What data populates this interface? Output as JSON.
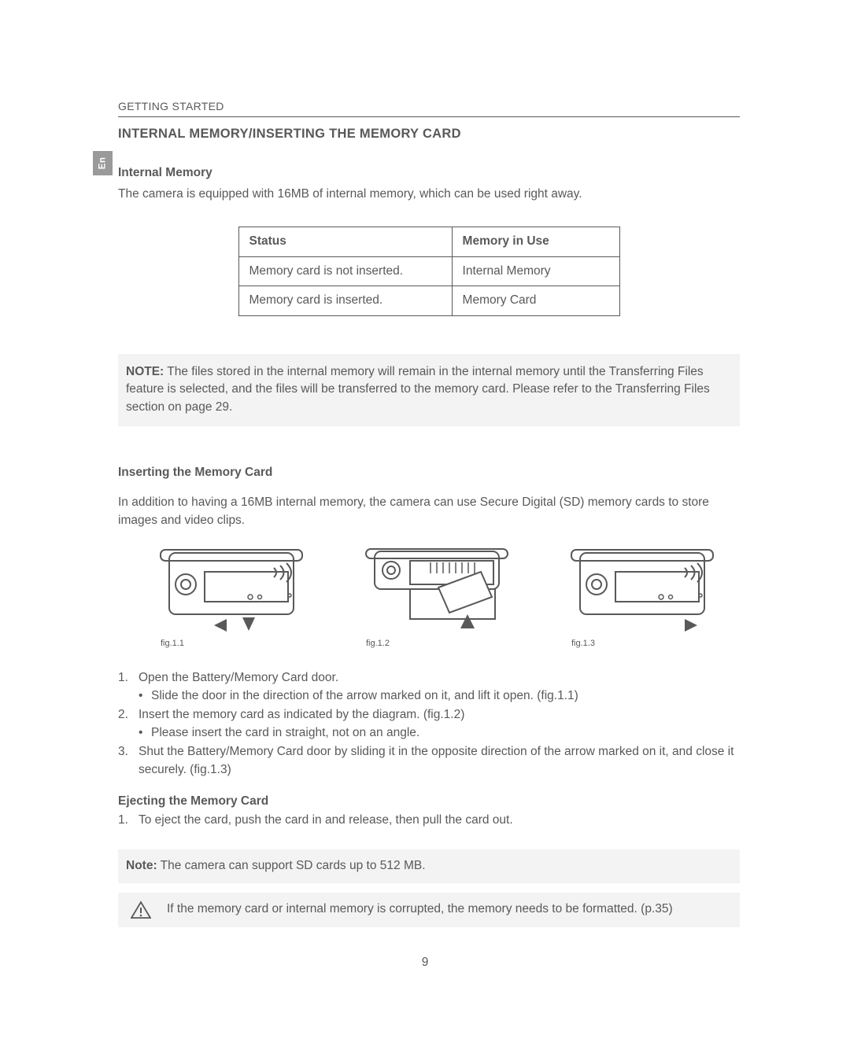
{
  "header": {
    "section": "GETTING STARTED",
    "title": "INTERNAL MEMORY/INSERTING THE MEMORY CARD",
    "language_tab": "En"
  },
  "internal_memory": {
    "heading": "Internal Memory",
    "body": "The camera is equipped with 16MB of internal memory, which can be used right away."
  },
  "chart_data": {
    "type": "table",
    "headers": [
      "Status",
      "Memory in Use"
    ],
    "rows": [
      [
        "Memory card is not inserted.",
        "Internal Memory"
      ],
      [
        "Memory card is inserted.",
        "Memory Card"
      ]
    ]
  },
  "note1": {
    "label": "NOTE:",
    "text": " The files stored in the internal memory will remain in the internal memory until the Transferring Files feature is selected, and the files will be transferred to the memory card.  Please refer to the Transferring Files section on page 29."
  },
  "inserting": {
    "heading": "Inserting the Memory Card",
    "intro": "In addition to having a 16MB internal memory, the camera can use Secure Digital (SD) memory cards to store images and video clips.",
    "fig_captions": [
      "fig.1.1",
      "fig.1.2",
      "fig.1.3"
    ],
    "steps": [
      {
        "text": "Open the Battery/Memory Card door.",
        "sub": "Slide the door in the direction of the arrow marked on it, and lift it open. (fig.1.1)"
      },
      {
        "text": "Insert the memory card as indicated by the diagram. (fig.1.2)",
        "sub": "Please insert the card in straight, not on an angle."
      },
      {
        "text": "Shut the Battery/Memory Card door by sliding it in the opposite direction of the arrow marked on it, and close it securely. (fig.1.3)",
        "sub": ""
      }
    ]
  },
  "ejecting": {
    "heading": "Ejecting the Memory Card",
    "step": "To eject the card, push the card in and release, then pull the card out."
  },
  "note2": {
    "label": "Note:",
    "text": " The camera can support SD cards up to 512 MB."
  },
  "warning": {
    "text": "If the memory card or internal memory is corrupted, the memory needs to be formatted. (p.35)"
  },
  "page_number": "9"
}
